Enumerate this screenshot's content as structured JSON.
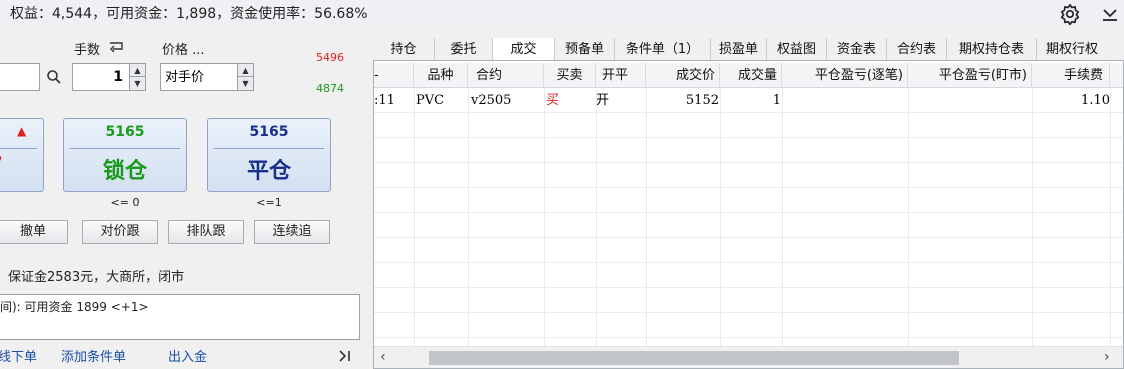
{
  "topbar": {
    "summary": "权益：4,544，可用资金：1,898，资金使用率：56.68%",
    "icons": [
      "gear-icon",
      "download-icon"
    ]
  },
  "order": {
    "qty_label": "手数",
    "price_label": "价格 ...",
    "qty_value": "1",
    "price_value": "对手价",
    "upper_limit": "5496",
    "lower_limit": "4874",
    "lock_button": {
      "price": "5165",
      "label": "锁仓"
    },
    "close_button": {
      "price": "5165",
      "label": "平仓"
    },
    "lock_hint": "<= 0",
    "close_hint": "<=1",
    "buttons": {
      "cancel": "撤单",
      "counter": "对价跟",
      "queue": "排队跟",
      "chase": "连续追"
    },
    "info": "保证金2583元，大商所，闭市",
    "log": "间): 可用资金 1899 <+1>",
    "links": {
      "l1": "线下单",
      "l2": "添加条件单",
      "l3": "出入金"
    },
    "colors": {
      "limit_up": "#e02020",
      "limit_down": "#1a9a1a",
      "lock_green": "#1a9a1a",
      "close_navy": "#1a2e8c"
    }
  },
  "tabs": [
    "持仓",
    "委托",
    "成交",
    "预备单",
    "条件单（1）",
    "损盈单",
    "权益图",
    "资金表",
    "合约表",
    "期权持仓表",
    "期权行权"
  ],
  "active_tab": "成交",
  "table": {
    "columns": [
      "-",
      "品种",
      "合约",
      "买卖",
      "开平",
      "成交价",
      "成交量",
      "平仓盈亏(逐笔)",
      "平仓盈亏(盯市)",
      "手续费"
    ],
    "rows": [
      {
        "time": ":11",
        "product": "PVC",
        "contract": "v2505",
        "side": "买",
        "offset": "开",
        "price": "5152",
        "volume": "1",
        "pnl_trade": "",
        "pnl_market": "",
        "fee": "1.10"
      }
    ]
  }
}
